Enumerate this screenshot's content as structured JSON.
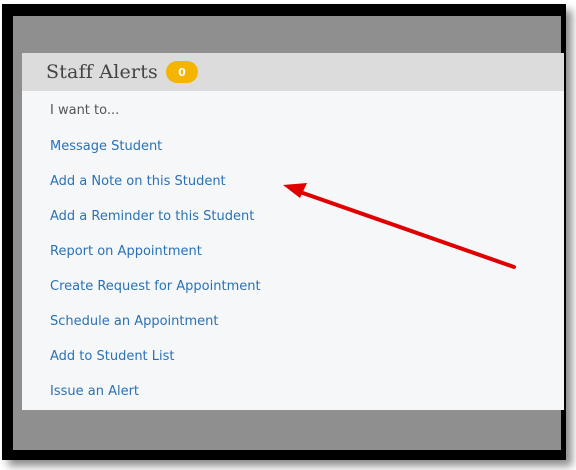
{
  "staff_alerts": {
    "title": "Staff Alerts",
    "badge_count": "0",
    "prompt": "I want to...",
    "actions": [
      {
        "label": "Message Student"
      },
      {
        "label": "Add a Note on this Student"
      },
      {
        "label": "Add a Reminder to this Student"
      },
      {
        "label": "Report on Appointment"
      },
      {
        "label": "Create Request for Appointment"
      },
      {
        "label": "Schedule an Appointment"
      },
      {
        "label": "Add to Student List"
      },
      {
        "label": "Issue an Alert"
      }
    ]
  },
  "annotation": {
    "arrow_color": "#e00000"
  },
  "colors": {
    "link": "#2a72b5",
    "badge": "#f5b400",
    "header": "#dcdcdc"
  }
}
